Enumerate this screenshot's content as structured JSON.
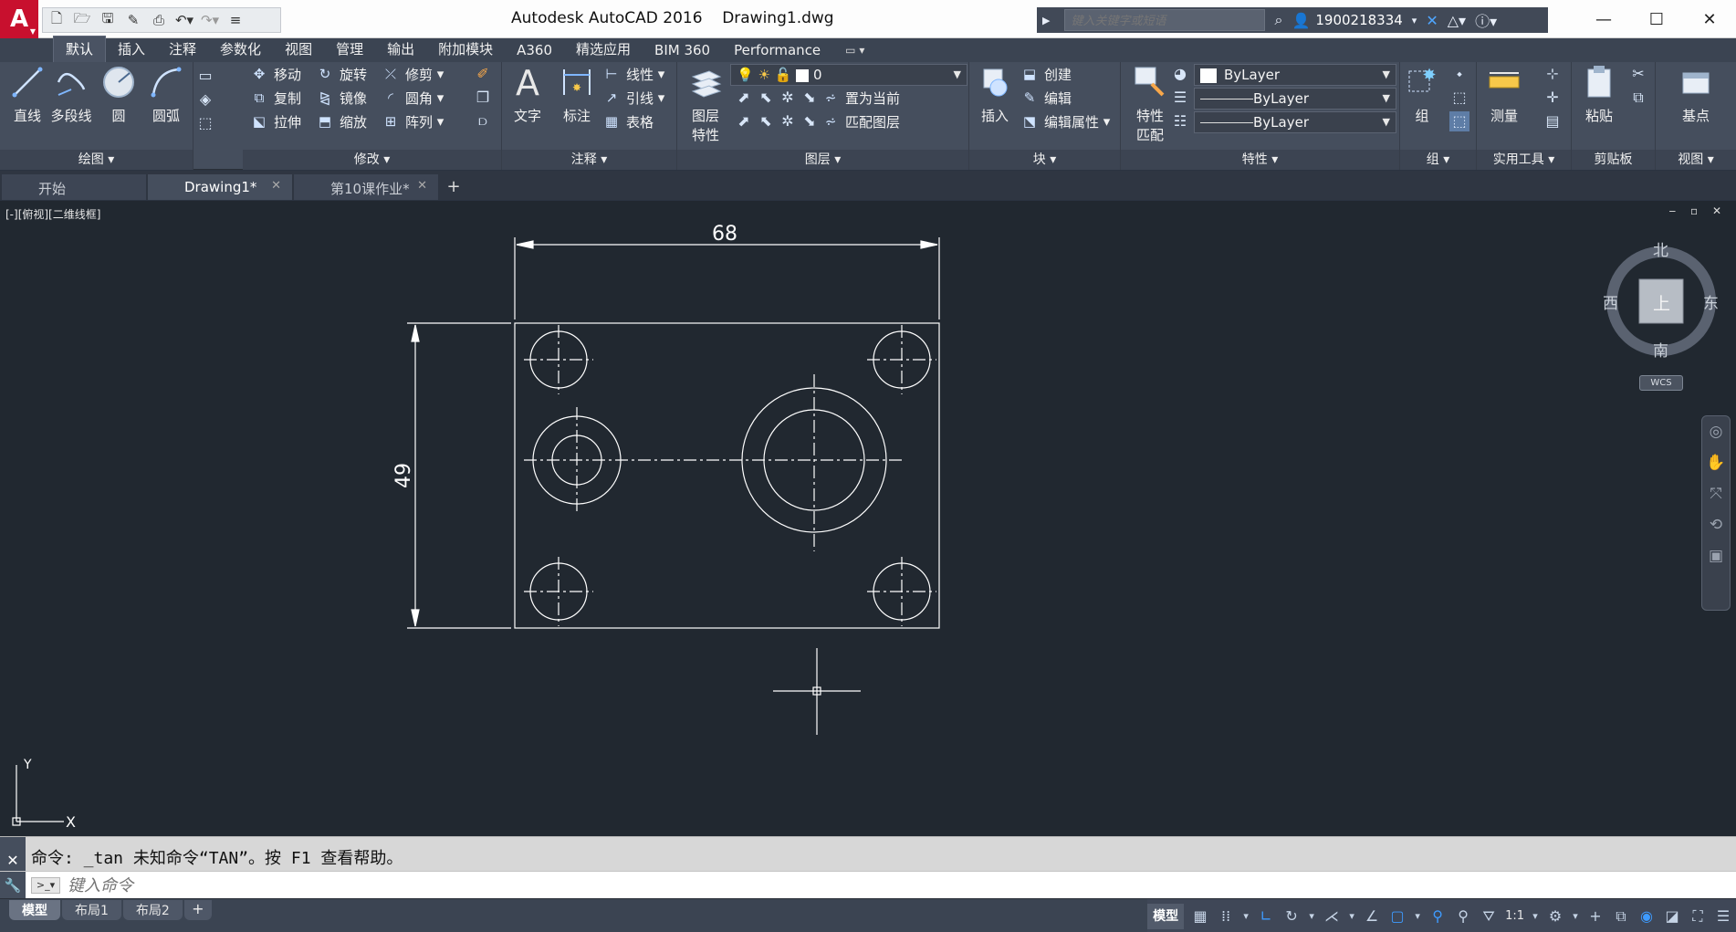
{
  "app": {
    "title": "Autodesk AutoCAD 2016",
    "document": "Drawing1.dwg",
    "logo": "A",
    "search_placeholder": "键入关键字或短语",
    "user": "1900218334",
    "icons": [
      "new-file-icon",
      "open-icon",
      "save-icon",
      "save-as-icon",
      "print-icon",
      "undo-icon",
      "redo-icon",
      "customize-icon"
    ]
  },
  "ribbon_tabs": [
    "默认",
    "插入",
    "注释",
    "参数化",
    "视图",
    "管理",
    "输出",
    "附加模块",
    "A360",
    "精选应用",
    "BIM 360",
    "Performance"
  ],
  "ribbon": {
    "draw": {
      "title": "绘图",
      "line": "直线",
      "polyline": "多段线",
      "circle": "圆",
      "arc": "圆弧"
    },
    "modify": {
      "title": "修改",
      "move": "移动",
      "rotate": "旋转",
      "trim": "修剪",
      "copy": "复制",
      "mirror": "镜像",
      "fillet": "圆角",
      "stretch": "拉伸",
      "scale": "缩放",
      "array": "阵列"
    },
    "annotation": {
      "title": "注释",
      "text": "文字",
      "dimension": "标注",
      "linear": "线性",
      "leader": "引线",
      "table": "表格"
    },
    "layers": {
      "title": "图层",
      "layer_props_1": "图层",
      "layer_props_2": "特性",
      "current_layer": "0",
      "set_current": "置为当前",
      "match_layer": "匹配图层"
    },
    "block": {
      "title": "块",
      "insert": "插入",
      "create": "创建",
      "edit": "编辑",
      "edit_attr": "编辑属性"
    },
    "properties": {
      "title": "特性",
      "match_1": "特性",
      "match_2": "匹配",
      "color": "ByLayer",
      "linetype": "ByLayer",
      "lineweight": "ByLayer"
    },
    "groups": {
      "title": "组",
      "group": "组"
    },
    "utilities": {
      "title": "实用工具",
      "measure": "测量"
    },
    "clipboard": {
      "title": "剪贴板",
      "paste": "粘贴"
    },
    "view": {
      "title": "视图",
      "base": "基点"
    }
  },
  "file_tabs": [
    {
      "label": "开始"
    },
    {
      "label": "Drawing1*"
    },
    {
      "label": "第10课作业*"
    }
  ],
  "viewport": {
    "label": "[-][俯视][二维线框]",
    "controls": "‒ ▫ ✕"
  },
  "drawing": {
    "dim_width": "68",
    "dim_height": "49",
    "ucs_x": "X",
    "ucs_y": "Y"
  },
  "viewcube": {
    "north": "北",
    "south": "南",
    "east": "东",
    "west": "西",
    "top": "上",
    "wcs": "WCS"
  },
  "command": {
    "history": "命令: _tan 未知命令“TAN”。按 F1 查看帮助。",
    "placeholder": "键入命令"
  },
  "layout_tabs": [
    "模型",
    "布局1",
    "布局2"
  ],
  "status": {
    "model": "模型",
    "scale": "1:1"
  },
  "colors": {
    "accent": "#c8102e",
    "canvas": "#212830",
    "ribbon": "#454e5d",
    "geometry": "#ffffff",
    "status_blue": "#3e9bff"
  }
}
